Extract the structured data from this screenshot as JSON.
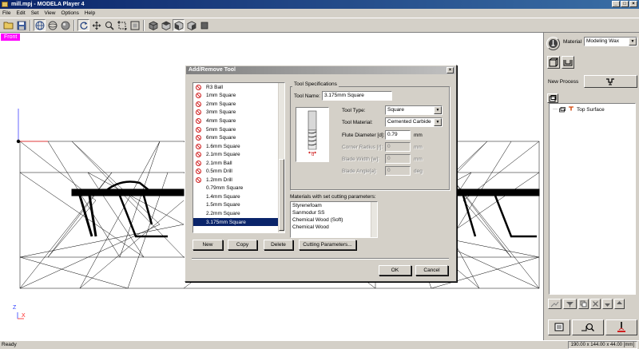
{
  "app": {
    "title": "mill.mpj - MODELA Player 4"
  },
  "menu": [
    "File",
    "Edit",
    "Set",
    "View",
    "Options",
    "Help"
  ],
  "viewport": {
    "view_label": "Front",
    "axis_z": "Z",
    "axis_x": "X"
  },
  "right_panel": {
    "material_label": "Material",
    "material_value": "Modeling Wax",
    "new_process_label": "New Process",
    "tree_item": "Top Surface"
  },
  "status": {
    "text": "Ready",
    "dimensions": "190.00 x 144.00 x 44.00 [mm]"
  },
  "dialog": {
    "title": "Add/Remove Tool",
    "tools": [
      {
        "name": "R3 Ball",
        "locked": true
      },
      {
        "name": "1mm Square",
        "locked": true
      },
      {
        "name": "2mm Square",
        "locked": true
      },
      {
        "name": "3mm Square",
        "locked": true
      },
      {
        "name": "4mm Square",
        "locked": true
      },
      {
        "name": "5mm Square",
        "locked": true
      },
      {
        "name": "6mm Square",
        "locked": true
      },
      {
        "name": "1.6mm Square",
        "locked": true
      },
      {
        "name": "2.1mm Square",
        "locked": true
      },
      {
        "name": "2.1mm Ball",
        "locked": true
      },
      {
        "name": "0.5mm Drill",
        "locked": true
      },
      {
        "name": "1.2mm Drill",
        "locked": true
      },
      {
        "name": "0.79mm Square",
        "locked": false
      },
      {
        "name": "1.4mm Square",
        "locked": false
      },
      {
        "name": "1.5mm Square",
        "locked": false
      },
      {
        "name": "2.2mm Square",
        "locked": false
      },
      {
        "name": "3.175mm Square",
        "locked": false,
        "selected": true
      }
    ],
    "buttons": {
      "new": "New",
      "copy": "Copy",
      "delete": "Delete",
      "cutting_params": "Cutting Parameters...",
      "ok": "OK",
      "cancel": "Cancel"
    },
    "spec": {
      "group_label": "Tool Specifications",
      "tool_name_label": "Tool Name:",
      "tool_name_value": "3.175mm Square",
      "tool_type_label": "Tool Type:",
      "tool_type_value": "Square",
      "tool_material_label": "Tool Material:",
      "tool_material_value": "Cemented Carbide",
      "flute_label": "Flute Diameter [d]:",
      "flute_value": "0.79",
      "flute_unit": "mm",
      "corner_label": "Corner Radius [r]:",
      "corner_value": "0",
      "corner_unit": "mm",
      "blade_width_label": "Blade Width [w]:",
      "blade_width_value": "0",
      "blade_width_unit": "mm",
      "blade_angle_label": "Blade Angle[a]:",
      "blade_angle_value": "0",
      "blade_angle_unit": "deg",
      "diagram_label": "d"
    },
    "materials_label": "Materials with set cutting parameters:",
    "materials": [
      "Styrenefoam",
      "Sanmodur SS",
      "Chemical Wood (Soft)",
      "Chemical Wood"
    ]
  }
}
